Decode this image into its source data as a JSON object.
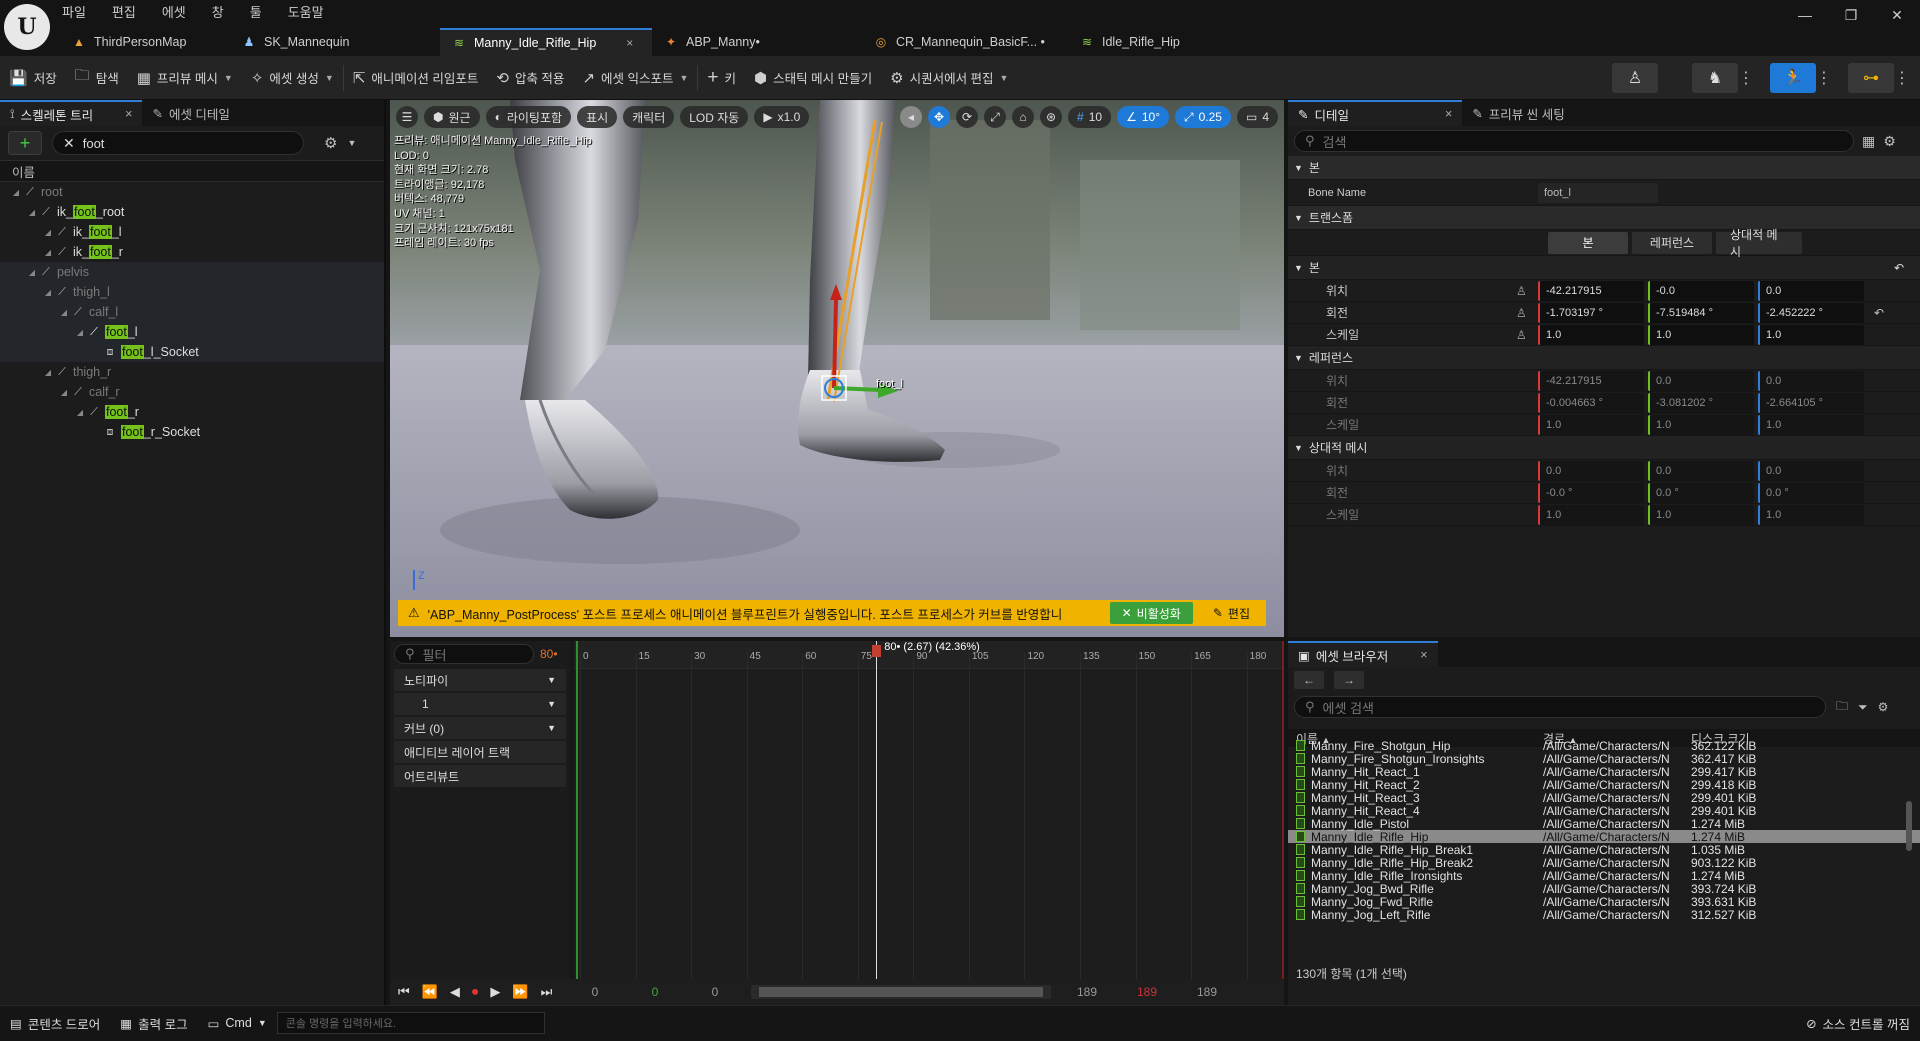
{
  "menu": [
    "파일",
    "편집",
    "에셋",
    "창",
    "툴",
    "도움말"
  ],
  "tabs": [
    {
      "label": "ThirdPersonMap",
      "icon": "map-icon"
    },
    {
      "label": "SK_Mannequin",
      "icon": "skeleton-icon"
    },
    {
      "label": "Manny_Idle_Rifle_Hip",
      "icon": "animation-icon",
      "close": "×"
    },
    {
      "label": "ABP_Manny•",
      "icon": "anim-blueprint-icon"
    },
    {
      "label": "CR_Mannequin_BasicF... •",
      "icon": "control-rig-icon"
    },
    {
      "label": "Idle_Rifle_Hip",
      "icon": "animation-icon"
    }
  ],
  "toolbar": {
    "save": "저장",
    "browse": "탐색",
    "preview_mesh": "프리뷰 메시",
    "create_asset": "에셋 생성",
    "retarget": "애니메이션 리임포트",
    "apply_compression": "압축 적용",
    "export_asset": "에셋 익스포트",
    "key": "키",
    "make_static_mesh": "스태틱 메시 만들기",
    "edit_in_sequencer": "시퀀서에서 편집"
  },
  "skeleton_panel": {
    "tab1": "스켈레톤 트리",
    "tab2": "에셋 디테일",
    "close": "×",
    "search_value": "foot",
    "header": "이름",
    "bones": [
      {
        "pre": "",
        "match": "",
        "post": "root",
        "depth": 0,
        "dim": true
      },
      {
        "pre": "ik_",
        "match": "foot",
        "post": "_root",
        "depth": 1
      },
      {
        "pre": "ik_",
        "match": "foot",
        "post": "_l",
        "depth": 2
      },
      {
        "pre": "ik_",
        "match": "foot",
        "post": "_r",
        "depth": 2
      },
      {
        "pre": "",
        "match": "",
        "post": "pelvis",
        "depth": 1,
        "dim": true
      },
      {
        "pre": "",
        "match": "",
        "post": "thigh_l",
        "depth": 2,
        "dim": true
      },
      {
        "pre": "",
        "match": "",
        "post": "calf_l",
        "depth": 3,
        "dim": true
      },
      {
        "pre": "",
        "match": "foot",
        "post": "_l",
        "depth": 4,
        "selected": true
      },
      {
        "pre": "",
        "match": "foot",
        "post": "_l_Socket",
        "depth": 5,
        "socket": true
      },
      {
        "pre": "",
        "match": "",
        "post": "thigh_r",
        "depth": 2,
        "dim": true
      },
      {
        "pre": "",
        "match": "",
        "post": "calf_r",
        "depth": 3,
        "dim": true
      },
      {
        "pre": "",
        "match": "foot",
        "post": "_r",
        "depth": 4
      },
      {
        "pre": "",
        "match": "foot",
        "post": "_r_Socket",
        "depth": 5,
        "socket": true
      }
    ]
  },
  "viewport": {
    "buttons": {
      "perspective": "원근",
      "lit": "라이팅포함",
      "show": "표시",
      "character": "캐릭터",
      "lod": "LOD 자동",
      "speed": "x1.0"
    },
    "snap": {
      "grid": "10",
      "angle": "10°",
      "scale": "0.25",
      "camera": "4"
    },
    "stats": [
      "프리뷰: 애니메이션 Manny_Idle_Rifle_Hip",
      "LOD: 0",
      "현재 화면 크기: 2.78",
      "트라이앵글: 92,178",
      "버텍스: 48,779",
      "UV 채널: 1",
      "크기 근사치: 121x75x181",
      "프레임 레이트: 30 fps"
    ],
    "bone_label": "foot_l",
    "warning": "'ABP_Manny_PostProcess' 포스트 프로세스 애니메이션 블루프린트가 실행중입니다. 포스트 프로세스가 커브를 반영합니",
    "disable": "비활성화",
    "edit": "편집",
    "axis_z": "Z"
  },
  "timeline": {
    "filter_placeholder": "필터",
    "frame": "80•",
    "rows": [
      "노티파이",
      "1",
      "커브  (0)",
      "애디티브 레이어 트랙",
      "어트리뷰트"
    ],
    "ticks": [
      "0",
      "15",
      "30",
      "45",
      "60",
      "75",
      "90",
      "105",
      "120",
      "135",
      "150",
      "165",
      "180"
    ],
    "playhead_label": "80• (2.67) (42.36%)",
    "playhead_frame": 80,
    "total_frames": 189,
    "counters": [
      "0",
      "0",
      "0",
      "189",
      "189",
      "189"
    ]
  },
  "details": {
    "tab1": "디테일",
    "tab2": "프리뷰 씬 세팅",
    "search_placeholder": "검색",
    "bone_section": "본",
    "bone_name_label": "Bone Name",
    "bone_name": "foot_l",
    "transform_section": "트랜스폼",
    "seg": [
      "본",
      "레퍼런스",
      "상대적 메시"
    ],
    "groups": [
      {
        "title": "본",
        "dim": false,
        "rows": [
          {
            "label": "위치",
            "vals": [
              "-42.217915",
              "-0.0",
              "0.0"
            ]
          },
          {
            "label": "회전",
            "vals": [
              "-1.703197 °",
              "-7.519484 °",
              "-2.452222 °"
            ]
          },
          {
            "label": "스케일",
            "vals": [
              "1.0",
              "1.0",
              "1.0"
            ]
          }
        ]
      },
      {
        "title": "레퍼런스",
        "dim": true,
        "rows": [
          {
            "label": "위치",
            "vals": [
              "-42.217915",
              "0.0",
              "0.0"
            ]
          },
          {
            "label": "회전",
            "vals": [
              "-0.004663 °",
              "-3.081202 °",
              "-2.664105 °"
            ]
          },
          {
            "label": "스케일",
            "vals": [
              "1.0",
              "1.0",
              "1.0"
            ]
          }
        ]
      },
      {
        "title": "상대적 메시",
        "dim": true,
        "rows": [
          {
            "label": "위치",
            "vals": [
              "0.0",
              "0.0",
              "0.0"
            ]
          },
          {
            "label": "회전",
            "vals": [
              "-0.0 °",
              "0.0 °",
              "0.0 °"
            ]
          },
          {
            "label": "스케일",
            "vals": [
              "1.0",
              "1.0",
              "1.0"
            ]
          }
        ]
      }
    ]
  },
  "asset_browser": {
    "tab": "에셋 브라우저",
    "close": "×",
    "search_placeholder": "에셋 검색",
    "columns": [
      "이름",
      "경로",
      "디스크 크기"
    ],
    "items": [
      {
        "name": "Manny_Fire_Shotgun_Hip",
        "path": "/All/Game/Characters/N",
        "size": "362.122 KiB"
      },
      {
        "name": "Manny_Fire_Shotgun_Ironsights",
        "path": "/All/Game/Characters/N",
        "size": "362.417 KiB"
      },
      {
        "name": "Manny_Hit_React_1",
        "path": "/All/Game/Characters/N",
        "size": "299.417 KiB"
      },
      {
        "name": "Manny_Hit_React_2",
        "path": "/All/Game/Characters/N",
        "size": "299.418 KiB"
      },
      {
        "name": "Manny_Hit_React_3",
        "path": "/All/Game/Characters/N",
        "size": "299.401 KiB"
      },
      {
        "name": "Manny_Hit_React_4",
        "path": "/All/Game/Characters/N",
        "size": "299.401 KiB"
      },
      {
        "name": "Manny_Idle_Pistol",
        "path": "/All/Game/Characters/N",
        "size": "1.274 MiB"
      },
      {
        "name": "Manny_Idle_Rifle_Hip",
        "path": "/All/Game/Characters/N",
        "size": "1.274 MiB",
        "selected": true
      },
      {
        "name": "Manny_Idle_Rifle_Hip_Break1",
        "path": "/All/Game/Characters/N",
        "size": "1.035 MiB"
      },
      {
        "name": "Manny_Idle_Rifle_Hip_Break2",
        "path": "/All/Game/Characters/N",
        "size": "903.122 KiB"
      },
      {
        "name": "Manny_Idle_Rifle_Ironsights",
        "path": "/All/Game/Characters/N",
        "size": "1.274 MiB"
      },
      {
        "name": "Manny_Jog_Bwd_Rifle",
        "path": "/All/Game/Characters/N",
        "size": "393.724 KiB"
      },
      {
        "name": "Manny_Jog_Fwd_Rifle",
        "path": "/All/Game/Characters/N",
        "size": "393.631 KiB"
      },
      {
        "name": "Manny_Jog_Left_Rifle",
        "path": "/All/Game/Characters/N",
        "size": "312.527 KiB"
      }
    ],
    "count": "130개 항목 (1개 선택)"
  },
  "statusbar": {
    "content_drawer": "콘텐츠 드로어",
    "output_log": "출력 로그",
    "cmd": "Cmd",
    "console_placeholder": "콘솔 명령을 입력하세요.",
    "source_control": "소스 컨트롤 꺼짐"
  },
  "colors": {
    "accent": "#2f7fd8",
    "match": "#75c21a",
    "warning": "#f0b400",
    "selection": "#1c3a5e"
  }
}
